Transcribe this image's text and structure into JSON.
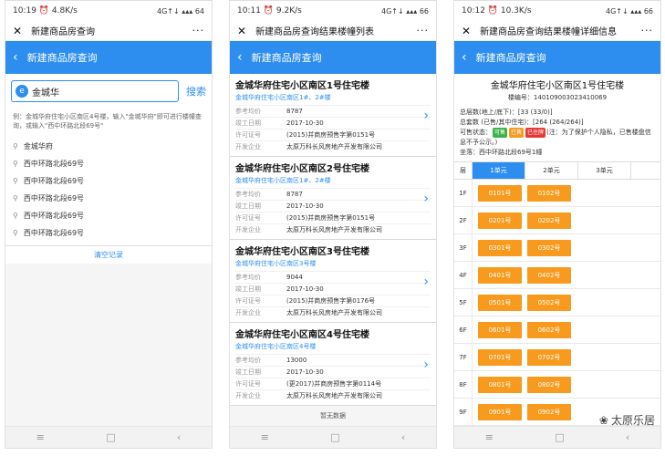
{
  "phone1": {
    "status": {
      "time": "10:19",
      "speed": "4.8K/s",
      "signal": "4G↑↓ ▴▴▴ 64"
    },
    "title": "新建商品房查询",
    "header": "新建商品房查询",
    "search": {
      "value": "金城华",
      "button": "搜索"
    },
    "hint": "例：金城华府住宅小区南区4号楼，输入\"金城华府\"即可进行楼幢查询，或输入\"西中环路北段69号\"",
    "history": [
      "金城华府",
      "西中环路北段69号",
      "西中环路北段69号",
      "西中环路北段69号",
      "西中环路北段69号",
      "西中环路北段69号"
    ],
    "clear": "清空记录"
  },
  "phone2": {
    "status": {
      "time": "10:11",
      "speed": "9.2K/s",
      "signal": "4G↑↓ ▴▴▴ 66"
    },
    "title": "新建商品房查询结果楼幢列表",
    "header": "新建商品房查询",
    "labels": {
      "price": "参考均价",
      "date": "竣工日期",
      "permit": "许可证号",
      "dev": "开发企业"
    },
    "cards": [
      {
        "title": "金城华府住宅小区南区1号住宅楼",
        "sub": "金城华府住宅小区南区1#、2#楼",
        "price": "8787",
        "date": "2017-10-30",
        "permit": "(2015)并商房预售字第0151号",
        "dev": "太原万科长风房地产开发有限公司"
      },
      {
        "title": "金城华府住宅小区南区2号住宅楼",
        "sub": "金城华府住宅小区南区1#、2#楼",
        "price": "8787",
        "date": "2017-10-30",
        "permit": "(2015)并商房预售字第0151号",
        "dev": "太原万科长风房地产开发有限公司"
      },
      {
        "title": "金城华府住宅小区南区3号住宅楼",
        "sub": "金城华府住宅小区南区3号楼",
        "price": "9044",
        "date": "2017-10-30",
        "permit": "(2015)并商房预售字第0176号",
        "dev": "太原万科长风房地产开发有限公司"
      },
      {
        "title": "金城华府住宅小区南区4号住宅楼",
        "sub": "金城华府住宅小区南区4号楼",
        "price": "13000",
        "date": "2017-10-30",
        "permit": "(更2017)并商房预售字第0114号",
        "dev": "太原万科长风房地产开发有限公司"
      }
    ],
    "nomore": "暂无数据"
  },
  "phone3": {
    "status": {
      "time": "10:12",
      "speed": "10.3K/s",
      "signal": "4G↑↓ ▴▴▴ 66"
    },
    "title": "新建商品房查询结果楼幢详细信息",
    "header": "新建商品房查询",
    "info": {
      "title": "金城华府住宅小区南区1号住宅楼",
      "building_no": "楼编号：140109003023410069",
      "floors": "总层数(地上/底下)：[33 (33/0)]",
      "units": "总套数 (已售/其中住宅)：[264 (264/264)]",
      "status_label": "可售状态：",
      "badge_available": "可售",
      "badge_sold": "已售",
      "badge_reserved": "已住牌",
      "status_note": "(注：为了保护个人隐私，已售楼盘信息不予公示。)",
      "location": "坐落：西中环路北段69号1幢"
    },
    "tabs": {
      "floor": "层",
      "u1": "1单元",
      "u2": "2单元",
      "u3": "3单元"
    },
    "floors": [
      {
        "f": "1F",
        "a": "0101号",
        "b": "0102号"
      },
      {
        "f": "2F",
        "a": "0201号",
        "b": "0202号"
      },
      {
        "f": "3F",
        "a": "0301号",
        "b": "0302号"
      },
      {
        "f": "4F",
        "a": "0401号",
        "b": "0402号"
      },
      {
        "f": "5F",
        "a": "0501号",
        "b": "0502号"
      },
      {
        "f": "6F",
        "a": "0601号",
        "b": "0602号"
      },
      {
        "f": "7F",
        "a": "0701号",
        "b": "0702号"
      },
      {
        "f": "8F",
        "a": "0801号",
        "b": "0802号"
      },
      {
        "f": "9F",
        "a": "0901号",
        "b": "0902号"
      }
    ],
    "watermark": "太原乐居"
  },
  "colors": {
    "blue": "#2d8ef0",
    "orange": "#f79a1e",
    "green": "#3cb34a",
    "red": "#e53935"
  }
}
